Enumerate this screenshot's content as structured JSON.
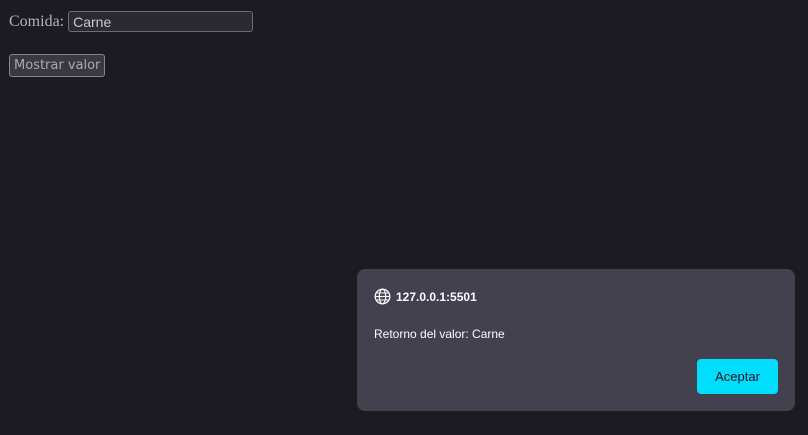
{
  "form": {
    "label": "Comida:",
    "input_value": "Carne",
    "button_label": "Mostrar valor"
  },
  "dialog": {
    "icon": "globe-icon",
    "origin": "127.0.0.1:5501",
    "message": "Retorno del valor: Carne",
    "accept_label": "Aceptar",
    "accent_color": "#00ddff"
  }
}
